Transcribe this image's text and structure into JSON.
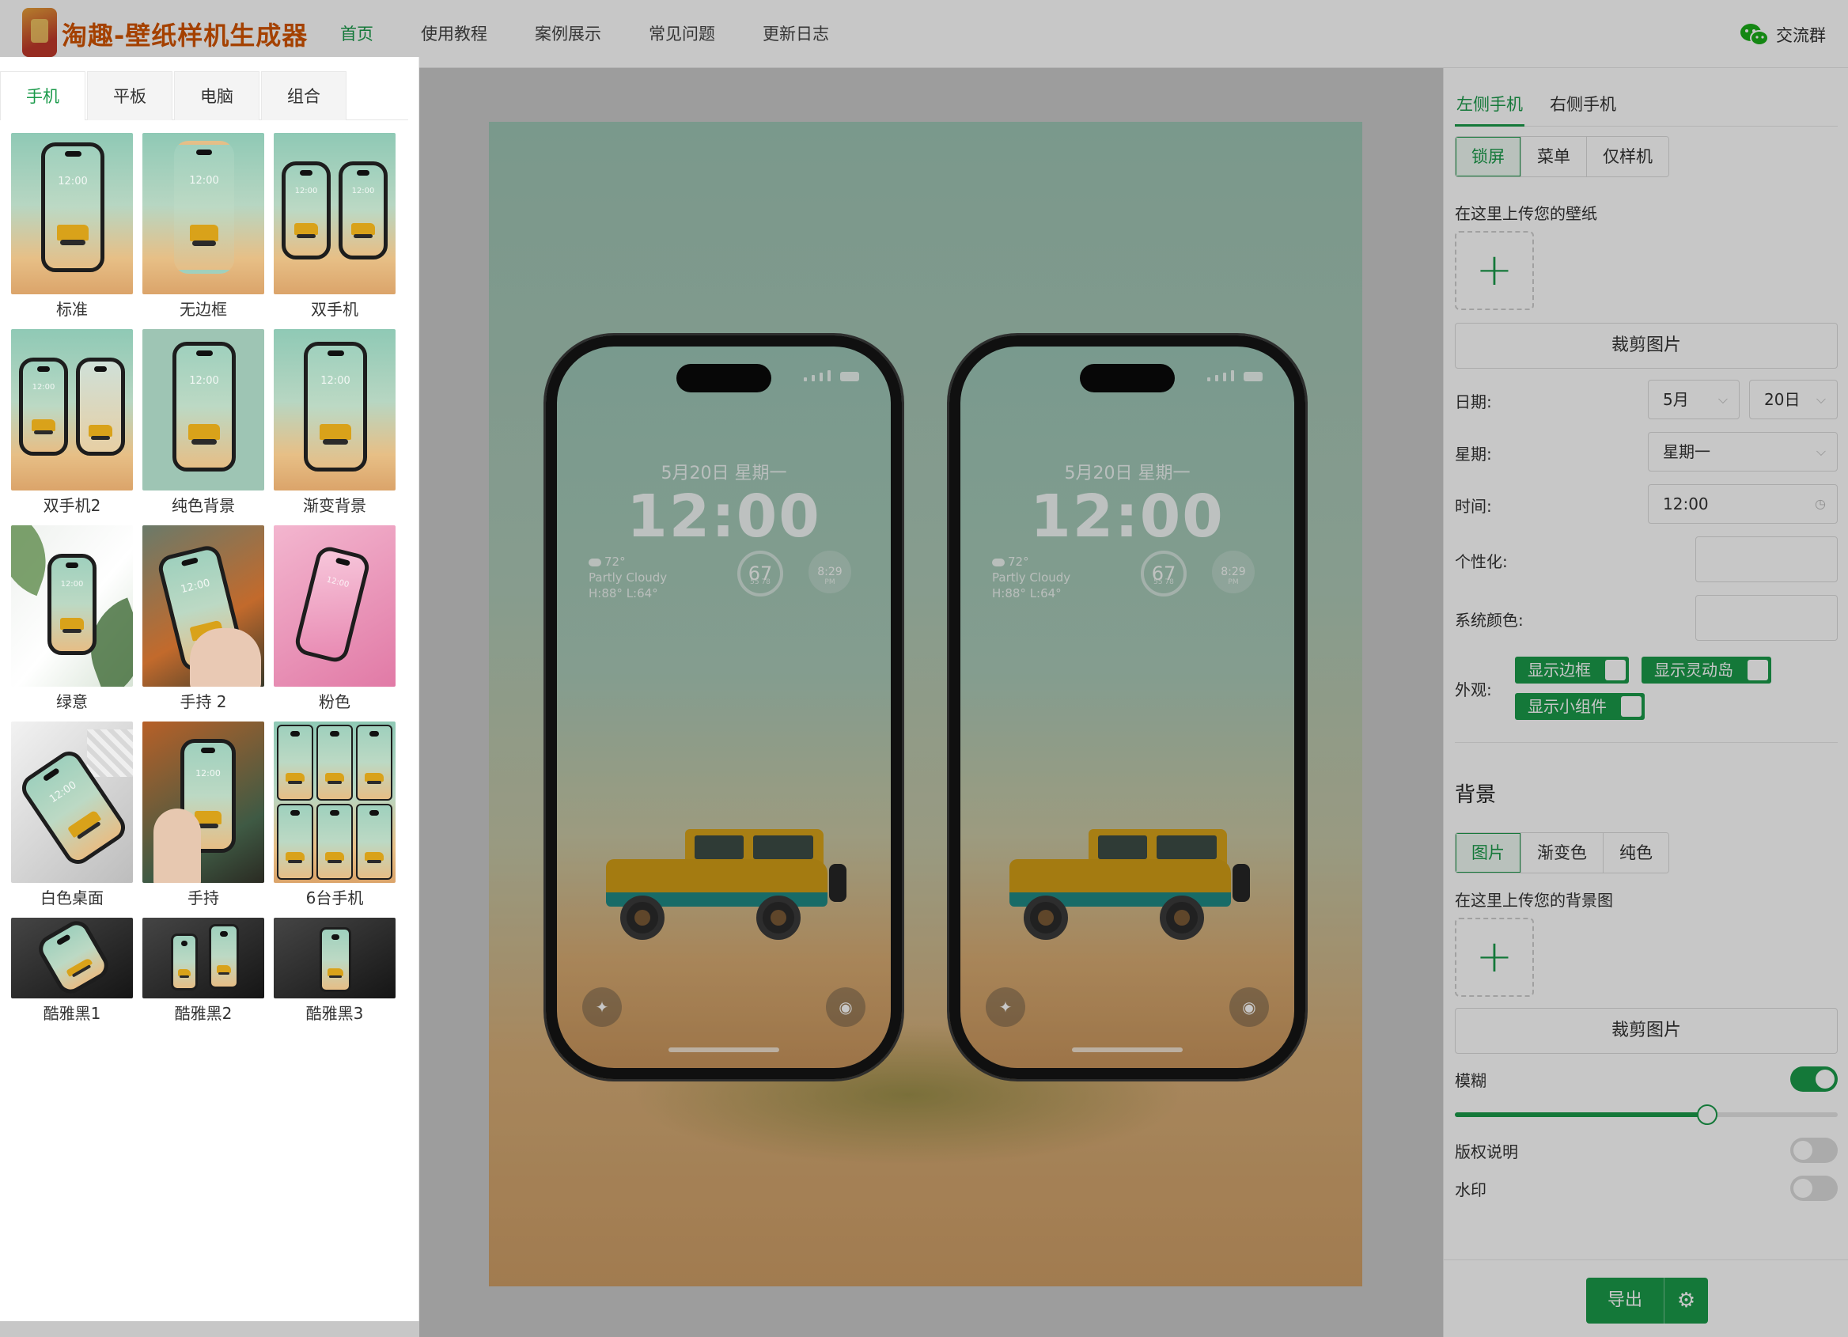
{
  "header": {
    "title": "淘趣-壁纸样机生成器",
    "nav": [
      {
        "label": "首页",
        "active": true
      },
      {
        "label": "使用教程",
        "active": false
      },
      {
        "label": "案例展示",
        "active": false
      },
      {
        "label": "常见问题",
        "active": false
      },
      {
        "label": "更新日志",
        "active": false
      }
    ],
    "group_link": "交流群",
    "group_icon": "wechat-icon"
  },
  "left_panel": {
    "tabs": [
      {
        "label": "手机",
        "active": true
      },
      {
        "label": "平板",
        "active": false
      },
      {
        "label": "电脑",
        "active": false
      },
      {
        "label": "组合",
        "active": false
      }
    ],
    "templates": [
      {
        "label": "标准"
      },
      {
        "label": "无边框"
      },
      {
        "label": "双手机"
      },
      {
        "label": "双手机2"
      },
      {
        "label": "纯色背景"
      },
      {
        "label": "渐变背景"
      },
      {
        "label": "绿意"
      },
      {
        "label": "手持 2"
      },
      {
        "label": "粉色"
      },
      {
        "label": "白色桌面"
      },
      {
        "label": "手持"
      },
      {
        "label": "6台手机"
      },
      {
        "label": "酷雅黑1"
      },
      {
        "label": "酷雅黑2"
      },
      {
        "label": "酷雅黑3"
      }
    ],
    "thumb_time": "12:00"
  },
  "preview": {
    "lock_date": "5月20日 星期一",
    "lock_time": "12:00",
    "weather_temp": "72°",
    "weather_desc": "Partly Cloudy",
    "weather_range": "H:88° L:64°",
    "ring_value": "67",
    "ring_sub": "55  78",
    "ring2_value": "8:29",
    "ring2_sub": "PM",
    "flashlight_icon": "flashlight-icon",
    "camera_icon": "camera-icon"
  },
  "right_panel": {
    "phone_tabs": [
      {
        "label": "左侧手机",
        "active": true
      },
      {
        "label": "右侧手机",
        "active": false
      }
    ],
    "mode_segments": [
      {
        "label": "锁屏",
        "active": true
      },
      {
        "label": "菜单",
        "active": false
      },
      {
        "label": "仅样机",
        "active": false
      }
    ],
    "upload_wallpaper_label": "在这里上传您的壁纸",
    "upload_plus": "+",
    "crop_label": "裁剪图片",
    "date_label": "日期:",
    "month_value": "5月",
    "day_value": "20日",
    "weekday_label": "星期:",
    "weekday_value": "星期一",
    "time_label": "时间:",
    "time_value": "12:00",
    "personalize_label": "个性化:",
    "system_color_label": "系统颜色:",
    "appearance_label": "外观:",
    "appearance_chips": [
      {
        "label": "显示边框"
      },
      {
        "label": "显示灵动岛"
      },
      {
        "label": "显示小组件"
      }
    ],
    "background_title": "背景",
    "bg_segments": [
      {
        "label": "图片",
        "active": true
      },
      {
        "label": "渐变色",
        "active": false
      },
      {
        "label": "纯色",
        "active": false
      }
    ],
    "upload_bg_label": "在这里上传您的背景图",
    "crop_bg_label": "裁剪图片",
    "blur_label": "模糊",
    "blur_on": true,
    "blur_level": 0.66,
    "copyright_label": "版权说明",
    "copyright_on": false,
    "watermark_label": "水印",
    "watermark_on": false,
    "export_label": "导出",
    "settings_icon": "gear-icon"
  },
  "colors": {
    "accent": "#1a9a4a",
    "brand_text": "#d35400"
  }
}
